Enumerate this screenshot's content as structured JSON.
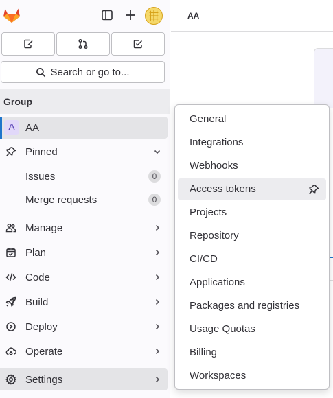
{
  "sidebar": {
    "quick_actions": [
      {
        "icon": "issues-icon"
      },
      {
        "icon": "merge-request-icon"
      },
      {
        "icon": "todo-icon"
      }
    ],
    "search_label": "Search or go to...",
    "section_title": "Group",
    "group": {
      "badge": "A",
      "name": "AA"
    },
    "pinned": {
      "label": "Pinned",
      "items": [
        {
          "label": "Issues",
          "count": "0"
        },
        {
          "label": "Merge requests",
          "count": "0"
        }
      ]
    },
    "nav": [
      {
        "label": "Manage",
        "icon": "users-icon"
      },
      {
        "label": "Plan",
        "icon": "planning-icon"
      },
      {
        "label": "Code",
        "icon": "code-icon"
      },
      {
        "label": "Build",
        "icon": "rocket-icon"
      },
      {
        "label": "Deploy",
        "icon": "deploy-icon"
      },
      {
        "label": "Operate",
        "icon": "cloud-gear-icon"
      }
    ],
    "settings_label": "Settings"
  },
  "header": {
    "breadcrumb": "AA"
  },
  "settings_flyout": {
    "items": [
      "General",
      "Integrations",
      "Webhooks",
      "Access tokens",
      "Projects",
      "Repository",
      "CI/CD",
      "Applications",
      "Packages and registries",
      "Usage Quotas",
      "Billing",
      "Workspaces"
    ],
    "active": "Access tokens"
  },
  "colors": {
    "accent": "#1f75cb",
    "sidebar_bg": "#fbfafd",
    "active_bg": "#ececef",
    "logo": "#e24329"
  }
}
